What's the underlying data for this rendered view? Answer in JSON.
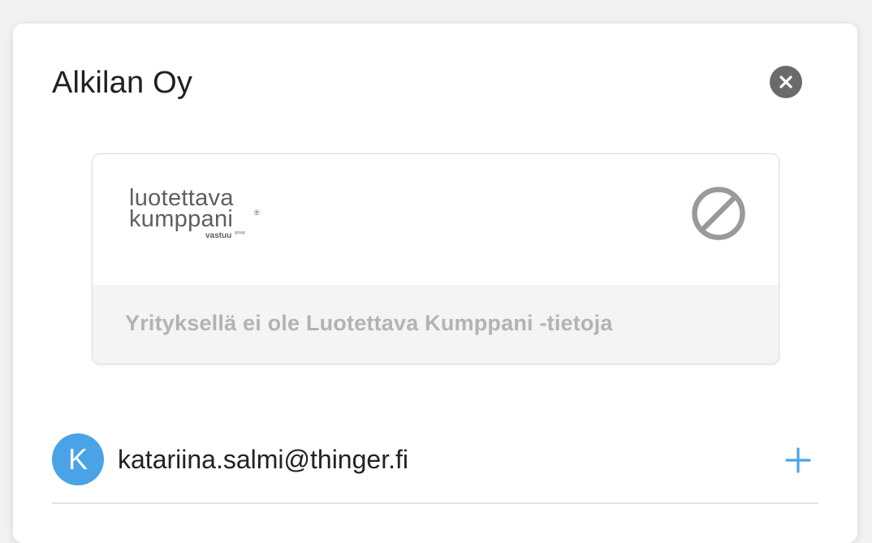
{
  "dialog": {
    "title": "Alkilan Oy",
    "close_icon": "close-circle-icon"
  },
  "trust_card": {
    "logo": {
      "line1": "luotettava",
      "line2": "kumppani",
      "registered_mark": "®",
      "sub": "vastuu",
      "sub_small": "group"
    },
    "status_icon": "blocked-icon",
    "message": "Yrityksellä ei ole Luotettava Kumppani -tietoja"
  },
  "account": {
    "avatar_letter": "K",
    "email": "katariina.salmi@thinger.fi",
    "add_icon": "plus-icon"
  },
  "colors": {
    "accent": "#4aa3e6",
    "close_bg": "#6b6b6b",
    "muted_text": "#b3b3b3"
  }
}
